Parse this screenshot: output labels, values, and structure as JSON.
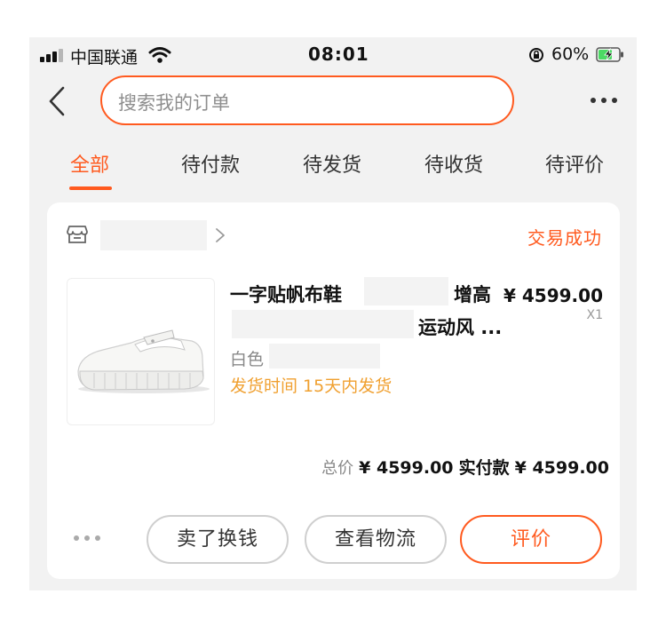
{
  "status_bar": {
    "carrier": "中国联通",
    "time": "08:01",
    "battery_percent": "60%",
    "signal_icon": "signal-bars-icon",
    "wifi_icon": "wifi-icon",
    "orientation_lock_icon": "orientation-lock-icon",
    "battery_icon": "battery-charging-icon"
  },
  "header": {
    "search_placeholder": "搜索我的订单",
    "back_icon": "chevron-left-icon",
    "more_icon": "more-horizontal-icon"
  },
  "tabs": [
    {
      "label": "全部",
      "active": true
    },
    {
      "label": "待付款",
      "active": false
    },
    {
      "label": "待发货",
      "active": false
    },
    {
      "label": "待收货",
      "active": false
    },
    {
      "label": "待评价",
      "active": false
    }
  ],
  "order": {
    "shop_icon": "store-icon",
    "status": "交易成功",
    "product": {
      "title_part1": "一字贴帆布鞋",
      "title_part2": "增高",
      "title_part3": "运动风 ...",
      "price": "¥ 4599.00",
      "quantity": "X1",
      "spec": "白色",
      "shipping": "发货时间 15天内发货"
    },
    "totals": {
      "total_label": "总价",
      "total_value": "¥ 4599.00",
      "paid_label": "实付款",
      "paid_value": "¥ 4599.00"
    },
    "actions": {
      "more_icon": "more-dots-icon",
      "sell_label": "卖了换钱",
      "logistics_label": "查看物流",
      "review_label": "评价"
    }
  },
  "colors": {
    "accent": "#ff5a1f",
    "shipping": "#f0a030",
    "background": "#f2f2f2"
  }
}
